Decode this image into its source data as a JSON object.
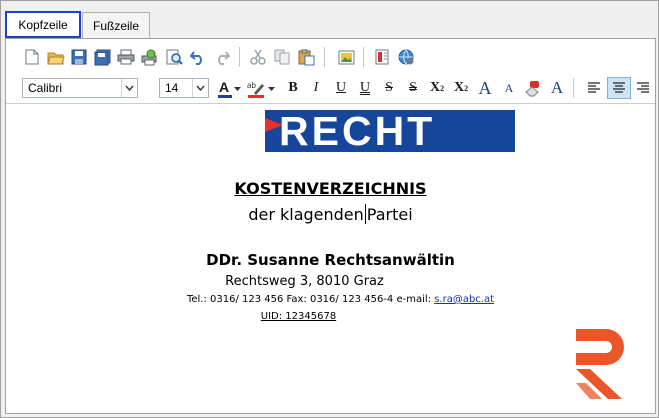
{
  "tabs": [
    {
      "label": "Kopfzeile",
      "active": true
    },
    {
      "label": "Fußzeile",
      "active": false
    }
  ],
  "toolbar1": {
    "icons": [
      "new-document-icon",
      "open-folder-icon",
      "save-icon",
      "save-all-icon",
      "print-icon",
      "print-preview-icon",
      "find-icon",
      "undo-icon",
      "redo-icon",
      "cut-icon",
      "copy-icon",
      "paste-icon",
      "insert-image-icon",
      "insert-page-icon",
      "insert-link-icon"
    ]
  },
  "format": {
    "font": "Calibri",
    "size": "14",
    "bold": "B",
    "italic": "I",
    "underline": "U",
    "double_underline": "U",
    "strike": "S",
    "double_strike": "S",
    "superscript": "X",
    "superscript_mark": "2",
    "subscript": "X",
    "subscript_mark": "2",
    "grow": "A",
    "shrink": "A",
    "style": "A",
    "alignment": "center"
  },
  "document": {
    "logo_text": "RECHT",
    "title": "KOSTENVERZEICHNIS",
    "subtitle_before_cursor": "der klagenden",
    "subtitle_after_cursor": "Partei",
    "name": "DDr. Susanne Rechtsanwältin",
    "address": "Rechtsweg 3, 8010 Graz",
    "contact": "Tel.: 0316/ 123 456 Fax: 0316/ 123 456-4 e-mail:",
    "email": "s.ra@abc.at",
    "uid": "UID: 12345678"
  },
  "colors": {
    "logo_blue": "#16469c",
    "logo_red": "#e5322d",
    "r_mark_orange": "#e8562a",
    "active_tab_border": "#1f3fc7",
    "link": "#1a2ec9"
  }
}
